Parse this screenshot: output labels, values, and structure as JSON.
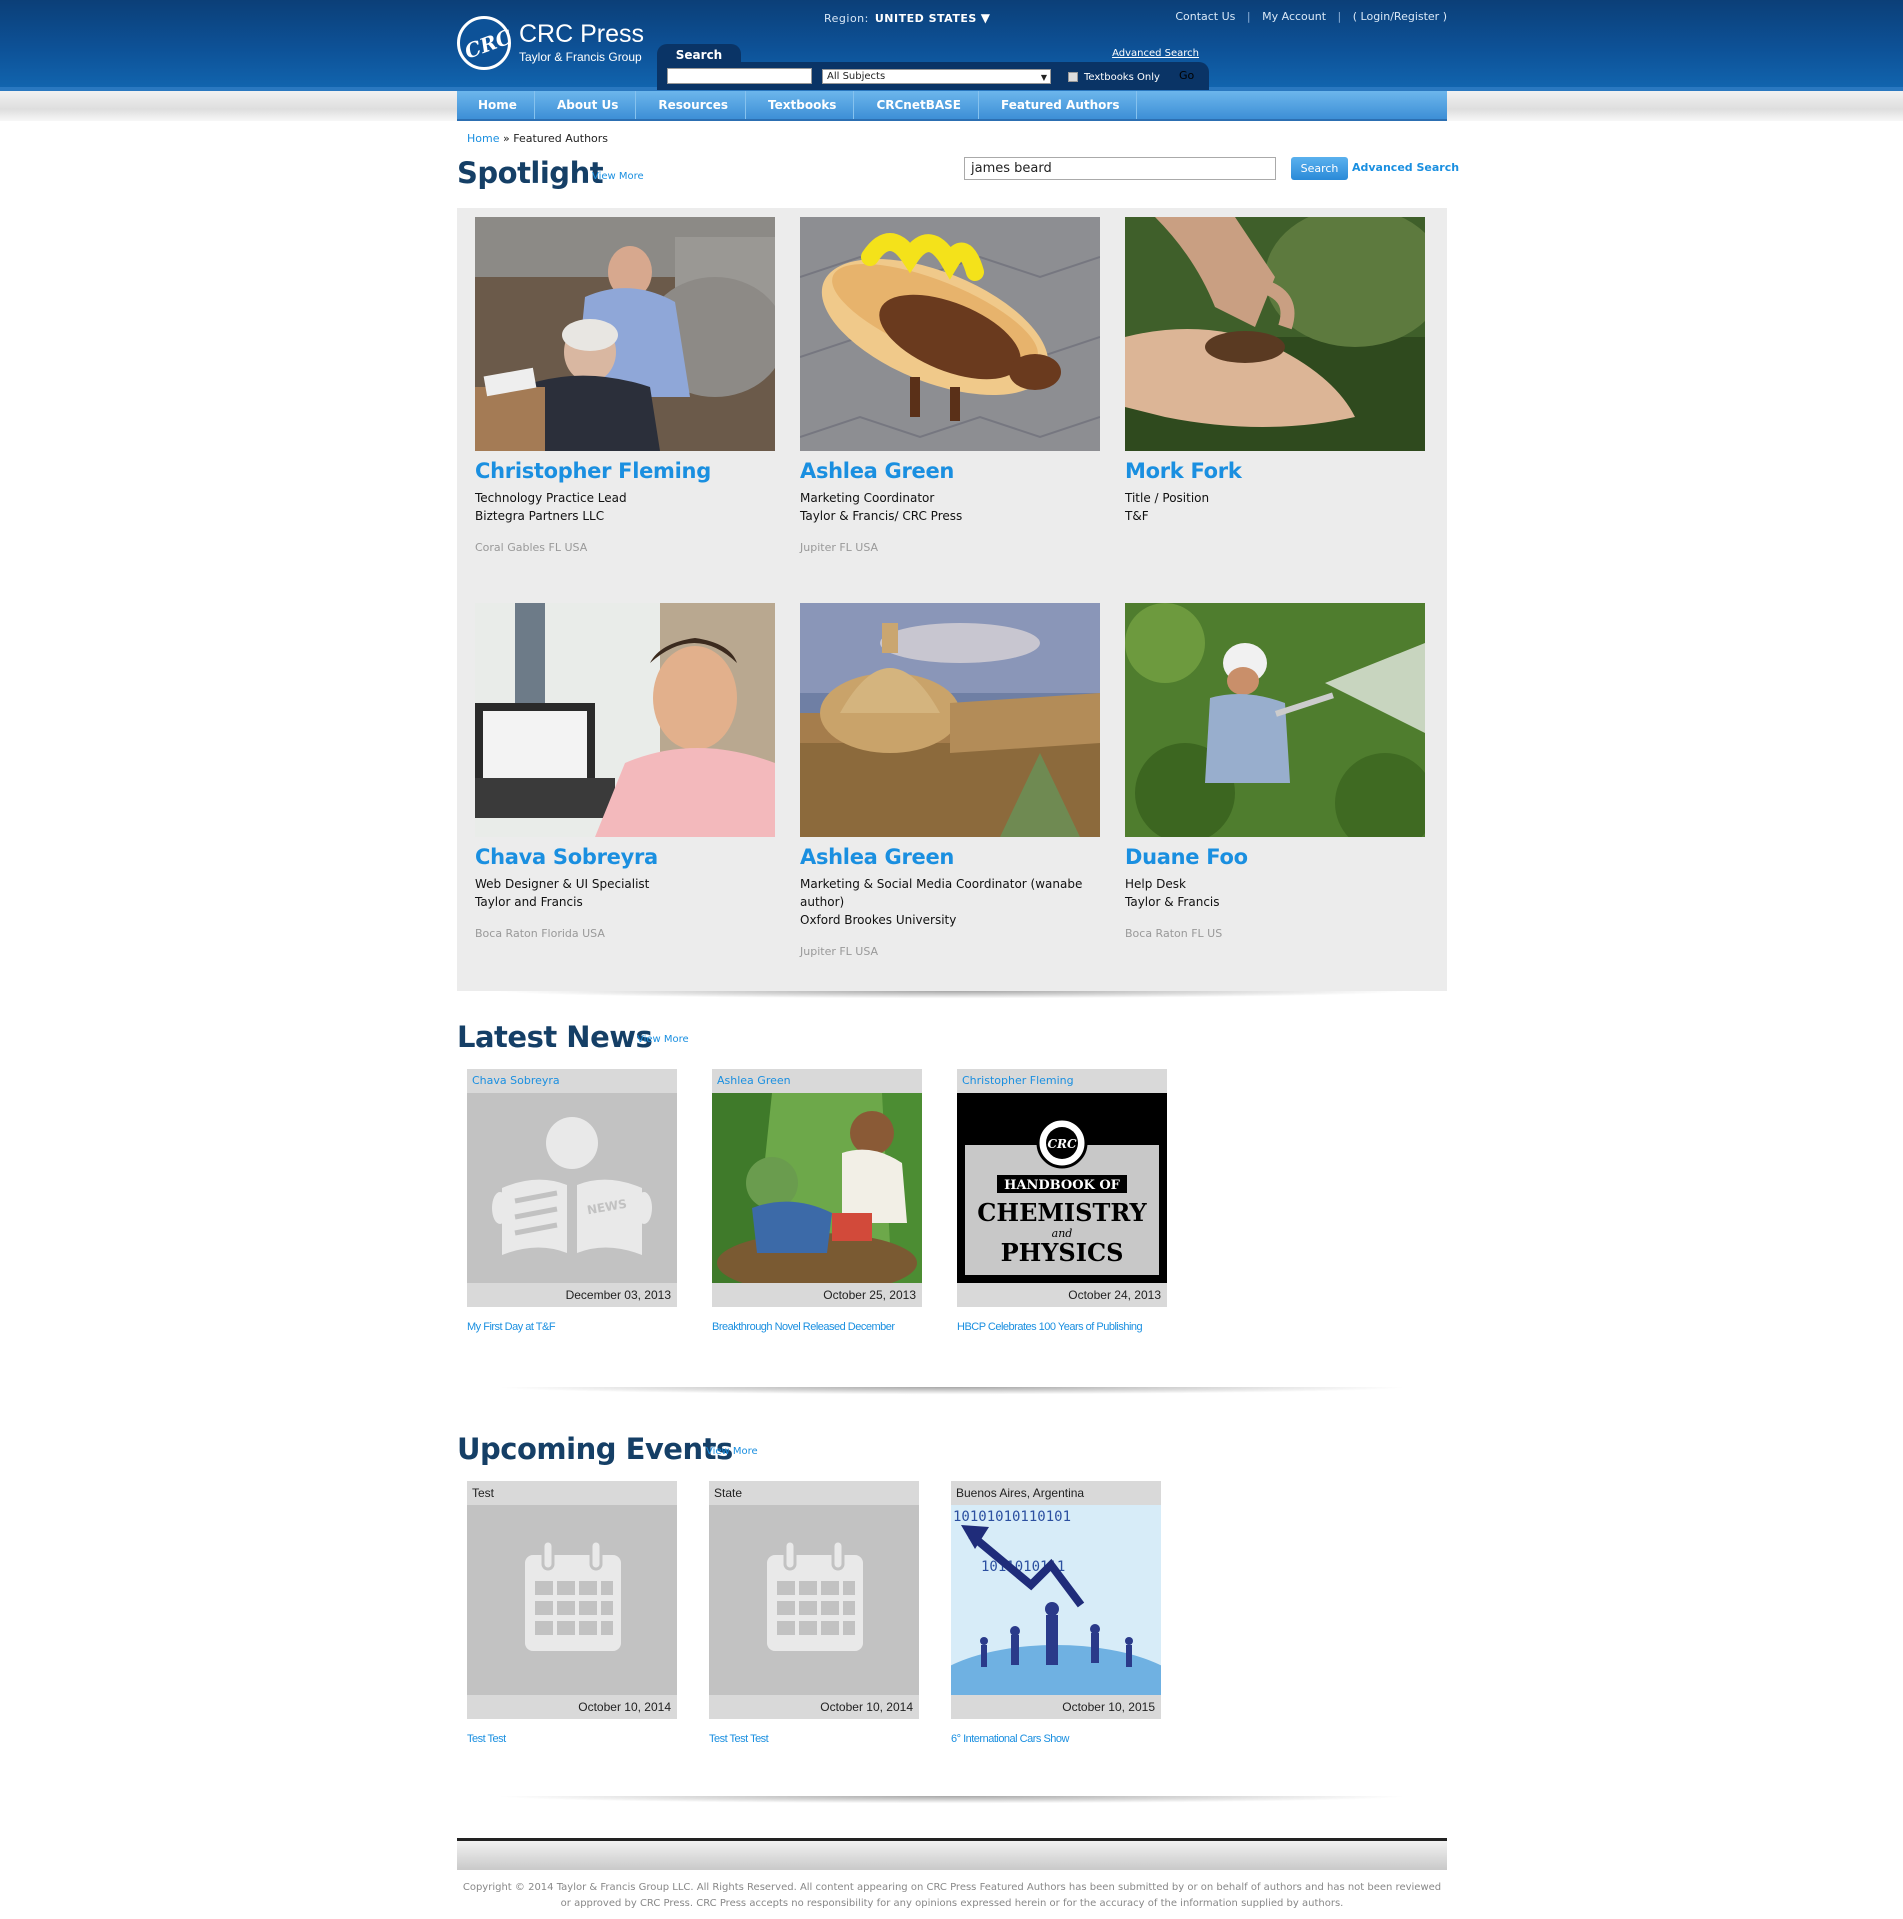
{
  "header": {
    "logo_text": "CRC",
    "brand": "CRC Press",
    "brand_sub": "Taylor & Francis Group",
    "region_label": "Region:",
    "region_value": "UNITED STATES",
    "links": [
      "Contact Us",
      "My Account",
      "( Login/Register )"
    ],
    "search_tab": "Search",
    "advanced_search": "Advanced Search",
    "search_value": "",
    "subject_select": "All Subjects",
    "textbooks_only": "Textbooks Only",
    "go": "Go"
  },
  "nav": [
    "Home",
    "About Us",
    "Resources",
    "Textbooks",
    "CRCnetBASE",
    "Featured Authors"
  ],
  "breadcrumb": {
    "home": "Home",
    "sep": "»",
    "current": "Featured Authors"
  },
  "spotlight": {
    "title": "Spotlight",
    "view_more": "View More",
    "search_value": "james beard",
    "search_button": "Search",
    "advanced_search": "Advanced Search",
    "people": [
      {
        "name": "Christopher Fleming",
        "role1": "Technology Practice Lead",
        "role2": "Biztegra Partners LLC",
        "role3": "",
        "location": "Coral Gables FL USA"
      },
      {
        "name": "Ashlea Green",
        "role1": "Marketing Coordinator",
        "role2": "Taylor & Francis/ CRC Press",
        "role3": "",
        "location": "Jupiter FL USA"
      },
      {
        "name": "Mork Fork",
        "role1": "Title / Position",
        "role2": "T&F",
        "role3": "",
        "location": ""
      },
      {
        "name": "Chava Sobreyra",
        "role1": "Web Designer & UI Specialist",
        "role2": "Taylor and Francis",
        "role3": "",
        "location": "Boca Raton Florida USA"
      },
      {
        "name": "Ashlea Green",
        "role1": "Marketing & Social Media Coordinator (wanabe author)",
        "role2": "Oxford Brookes University",
        "role3": "",
        "location": "Jupiter FL USA"
      },
      {
        "name": "Duane Foo",
        "role1": "Help Desk",
        "role2": "Taylor & Francis",
        "role3": "",
        "location": "Boca Raton FL US"
      }
    ]
  },
  "news": {
    "title": "Latest News",
    "view_more": "View More",
    "items": [
      {
        "author": "Chava Sobreyra",
        "date": "December 03, 2013",
        "headline": "My First Day at T&F"
      },
      {
        "author": "Ashlea Green",
        "date": "October 25, 2013",
        "headline": "Breakthrough Novel Released December"
      },
      {
        "author": "Christopher Fleming",
        "date": "October 24, 2013",
        "headline": "HBCP Celebrates 100 Years of Publishing"
      }
    ],
    "cover_text": {
      "badge": "CRC",
      "line1": "HANDBOOK OF",
      "line2": "CHEMISTRY",
      "line3": "and",
      "line4": "PHYSICS",
      "news_badge": "NEWS"
    }
  },
  "events": {
    "title": "Upcoming Events",
    "view_more": "View More",
    "items": [
      {
        "location": "Test",
        "date": "October 10, 2014",
        "headline": "Test Test"
      },
      {
        "location": "State",
        "date": "October 10, 2014",
        "headline": "Test Test Test"
      },
      {
        "location": "Buenos Aires, Argentina",
        "date": "October 10, 2015",
        "headline": "6° International Cars Show"
      }
    ]
  },
  "footer": {
    "copyright": "Copyright © 2014 Taylor & Francis Group LLC. All Rights Reserved. All content appearing on CRC Press Featured Authors has been submitted by or on behalf of authors and has not been reviewed or approved by CRC Press. CRC Press accepts no responsibility for any opinions expressed herein or for the accuracy of the information supplied by authors."
  },
  "colors": {
    "brand_dark": "#0c3f78",
    "link_blue": "#1a8fe0",
    "title_navy": "#153f66",
    "nav_blue": "#3d8fd6"
  }
}
